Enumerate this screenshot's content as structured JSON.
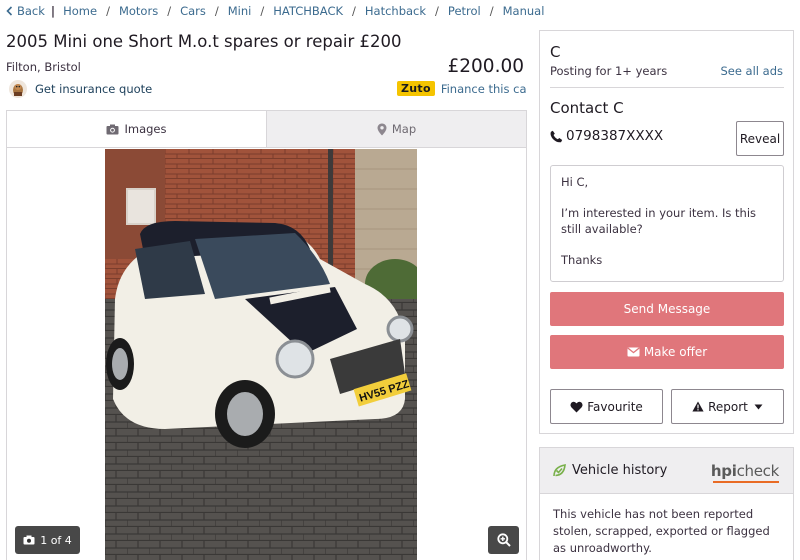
{
  "breadcrumb": {
    "back_label": "Back",
    "items": [
      "Home",
      "Motors",
      "Cars",
      "Mini",
      "HATCHBACK",
      "Hatchback",
      "Petrol",
      "Manual"
    ]
  },
  "listing": {
    "title": "2005 Mini one Short M.o.t spares or repair £200",
    "location": "Filton, Bristol",
    "price": "£200.00",
    "insurance_link": "Get insurance quote",
    "finance_brand": "Zuto",
    "finance_link": "Finance this car"
  },
  "gallery": {
    "tab_images": "Images",
    "tab_map": "Map",
    "counter": "1 of 4",
    "plate_text": "HV55 PZZ"
  },
  "seller": {
    "name": "C",
    "posting": "Posting for 1+ years",
    "see_all": "See all ads",
    "contact_heading": "Contact C",
    "phone": "0798387XXXX",
    "reveal_label": "Reveal",
    "message_greeting": "Hi C,",
    "message_body": "I’m interested in your item. Is this still available?",
    "message_signoff": "Thanks",
    "send_label": "Send Message",
    "offer_label": "Make offer",
    "favourite_label": "Favourite",
    "report_label": "Report"
  },
  "history": {
    "heading": "Vehicle history",
    "brand_hpi": "hpi",
    "brand_check": "check",
    "text": "This vehicle has not been reported stolen, scrapped, exported or flagged as unroadworthy."
  },
  "colors": {
    "accent_button": "#e0767b",
    "link": "#3c6b8f",
    "zuto_yellow": "#f5c400",
    "hpi_orange": "#e96b25"
  },
  "icons": [
    "chevron-left-icon",
    "camera-icon",
    "map-pin-icon",
    "phone-icon",
    "envelope-icon",
    "heart-icon",
    "warning-icon",
    "caret-down-icon",
    "zoom-icon",
    "leaf-check-icon",
    "meerkat-icon"
  ]
}
